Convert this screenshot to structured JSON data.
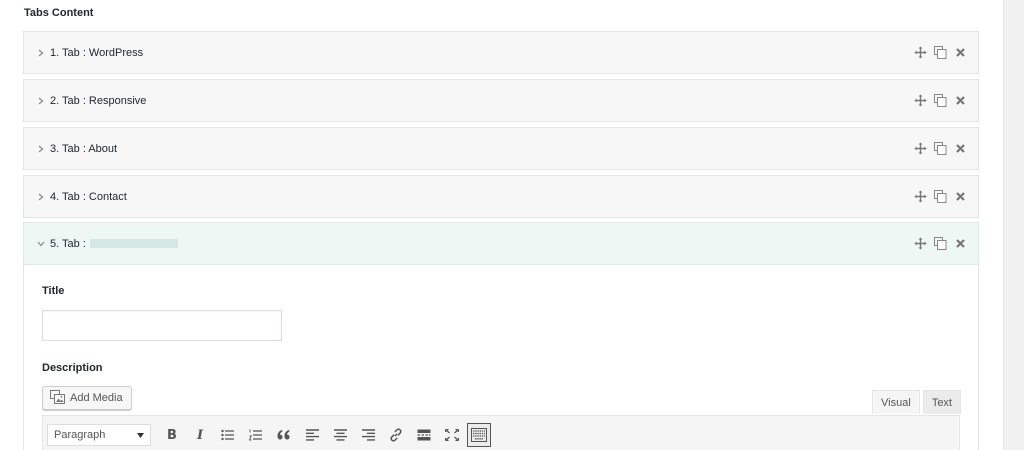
{
  "section": {
    "title": "Tabs Content"
  },
  "tabs": [
    {
      "label": "1. Tab : WordPress",
      "expanded": false
    },
    {
      "label": "2. Tab : Responsive",
      "expanded": false
    },
    {
      "label": "3. Tab : About",
      "expanded": false
    },
    {
      "label": "4. Tab : Contact",
      "expanded": false
    },
    {
      "label": "5. Tab :",
      "expanded": true
    }
  ],
  "row_actions": [
    "move-icon",
    "duplicate-icon",
    "remove-icon"
  ],
  "panel": {
    "title_label": "Title",
    "title_value": "",
    "description_label": "Description",
    "add_media_label": "Add Media",
    "editor_tabs": {
      "visual": "Visual",
      "text": "Text",
      "active": "Visual"
    },
    "format_select": "Paragraph",
    "toolbar_buttons": [
      "bold-icon",
      "italic-icon",
      "bulleted-list-icon",
      "numbered-list-icon",
      "blockquote-icon",
      "align-left-icon",
      "align-center-icon",
      "align-right-icon",
      "insert-link-icon",
      "read-more-icon",
      "fullscreen-icon",
      "toolbar-toggle-icon"
    ]
  },
  "colors": {
    "collapsed_row_bg": "#f7f7f7",
    "expanded_row_bg": "#eef7f4",
    "border": "#e5e5e5",
    "icon": "#777777"
  }
}
